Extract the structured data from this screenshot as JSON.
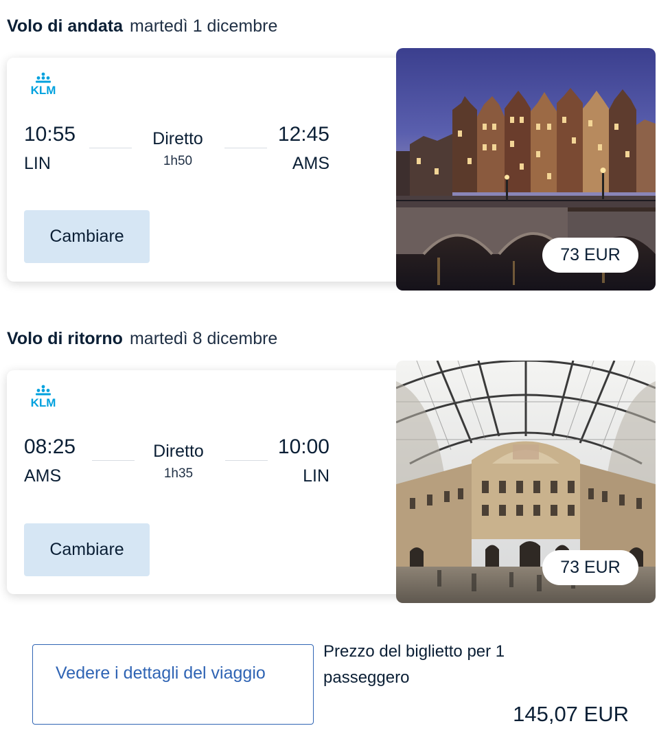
{
  "outbound": {
    "kind": "Volo di andata",
    "date": "martedì 1 dicembre",
    "airline": "KLM",
    "depart_time": "10:55",
    "depart_code": "LIN",
    "mode": "Diretto",
    "duration": "1h50",
    "arrive_time": "12:45",
    "arrive_code": "AMS",
    "change_label": "Cambiare",
    "price": "73 EUR",
    "photo_icon": "amsterdam-canal-photo"
  },
  "return": {
    "kind": "Volo di ritorno",
    "date": "martedì 8 dicembre",
    "airline": "KLM",
    "depart_time": "08:25",
    "depart_code": "AMS",
    "mode": "Diretto",
    "duration": "1h35",
    "arrive_time": "10:00",
    "arrive_code": "LIN",
    "change_label": "Cambiare",
    "price": "73 EUR",
    "photo_icon": "milan-galleria-photo"
  },
  "summary": {
    "details_label": "Vedere i dettagli del viaggio",
    "price_label": "Prezzo del biglietto per 1 passeggero",
    "total": "145,07 EUR"
  },
  "colors": {
    "brand_blue": "#00a1de",
    "link_blue": "#2f64b4",
    "button_bg": "#d6e6f4",
    "text_dark": "#0b1f35"
  }
}
